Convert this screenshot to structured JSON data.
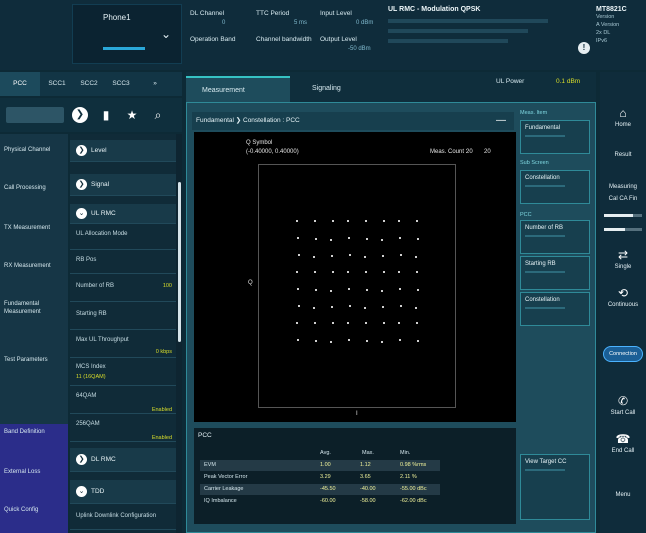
{
  "header": {
    "phone": "Phone1",
    "fields": [
      {
        "label": "DL Channel",
        "value": "0"
      },
      {
        "label": "TTC Period",
        "value": "5 ms"
      },
      {
        "label": "Input Level",
        "value": "0 dBm"
      },
      {
        "label": "Operation Band",
        "value": ""
      },
      {
        "label": "Channel bandwidth",
        "value": ""
      },
      {
        "label": "Output Level",
        "value": "-50 dBm"
      }
    ],
    "status_title": "UL RMC - Modulation QPSK",
    "instrument": {
      "model": "MT8821C",
      "info": [
        "Version",
        "A Version",
        "2x DL",
        "IPv6"
      ]
    }
  },
  "cc_tabs": [
    "PCC",
    "SCC1",
    "SCC2",
    "SCC3",
    "»"
  ],
  "categories": [
    {
      "label": "Physical Channel"
    },
    {
      "label": "Call Processing"
    },
    {
      "label": "TX Measurement"
    },
    {
      "label": "RX Measurement"
    },
    {
      "label": "Fundamental Measurement"
    },
    {
      "label": "Test Parameters"
    },
    {
      "label": "Band Definition"
    },
    {
      "label": "External Loss"
    },
    {
      "label": "Quick Config"
    }
  ],
  "params": [
    {
      "label": "Level",
      "head": true
    },
    {
      "label": "Signal",
      "head": true
    },
    {
      "label": "UL RMC",
      "head": true
    },
    {
      "label": "UL Allocation Mode",
      "value": ""
    },
    {
      "label": "RB Pos",
      "value": ""
    },
    {
      "label": "Number of RB",
      "value": "100"
    },
    {
      "label": "Starting RB",
      "value": ""
    },
    {
      "label": "Max UL Throughput",
      "value": "0 kbps"
    },
    {
      "label": "MCS Index",
      "sub": "11 (16QAM)"
    },
    {
      "label": "64QAM",
      "value": "Enabled"
    },
    {
      "label": "256QAM",
      "value": "Enabled"
    },
    {
      "label": "DL RMC",
      "head": true
    },
    {
      "label": "TDD",
      "head": true
    },
    {
      "label": "Uplink Downlink Configuration",
      "value": ""
    }
  ],
  "main_tabs": [
    "Measurement",
    "Signaling"
  ],
  "ul_power": {
    "label": "UL Power",
    "value": "0.1 dBm"
  },
  "meas_title": "Fundamental ❯ Constellation : PCC",
  "plot": {
    "symbol_label": "Q Symbol",
    "symbol_value": "(-0.40000, 0.40000)",
    "meas_count_label": "Meas. Count :",
    "meas_count": "20",
    "meas_count_total": "20",
    "axis_q": "Q",
    "axis_i": "I"
  },
  "table": {
    "section": "PCC",
    "headers": [
      "",
      "Avg.",
      "Max.",
      "Min."
    ],
    "rows": [
      {
        "name": "EVM",
        "avg": "1.00",
        "max": "1.12",
        "min": "0.98 %rms"
      },
      {
        "name": "Peak Vector Error",
        "avg": "3.29",
        "max": "3.65",
        "min": "2.11 %"
      },
      {
        "name": "Carrier Leakage",
        "avg": "-45.50",
        "max": "-40.00",
        "min": "-55.00 dBc"
      },
      {
        "name": "IQ Imbalance",
        "avg": "-60.00",
        "max": "-58.00",
        "min": "-62.00 dBc"
      }
    ]
  },
  "side_panel": [
    {
      "label": "Meas. Item",
      "button": "Fundamental"
    },
    {
      "label": "Sub Screen",
      "button": "Constellation"
    },
    {
      "label": "PCC",
      "button": "Number of RB"
    },
    {
      "label": "",
      "button": "Starting RB"
    },
    {
      "label": "",
      "button": "Constellation"
    },
    {
      "label": "",
      "button": "View Target CC"
    }
  ],
  "right_bar": {
    "home": "Home",
    "result": "Result",
    "measuring": "Measuring",
    "mode": "Cal CA Fin",
    "single": "Single",
    "continuous": "Continuous",
    "connection": "Connection",
    "start_call": "Start Call",
    "end_call": "End Call",
    "menu": "Menu",
    "slider1_level": 0.75,
    "slider2_level": 0.55
  }
}
